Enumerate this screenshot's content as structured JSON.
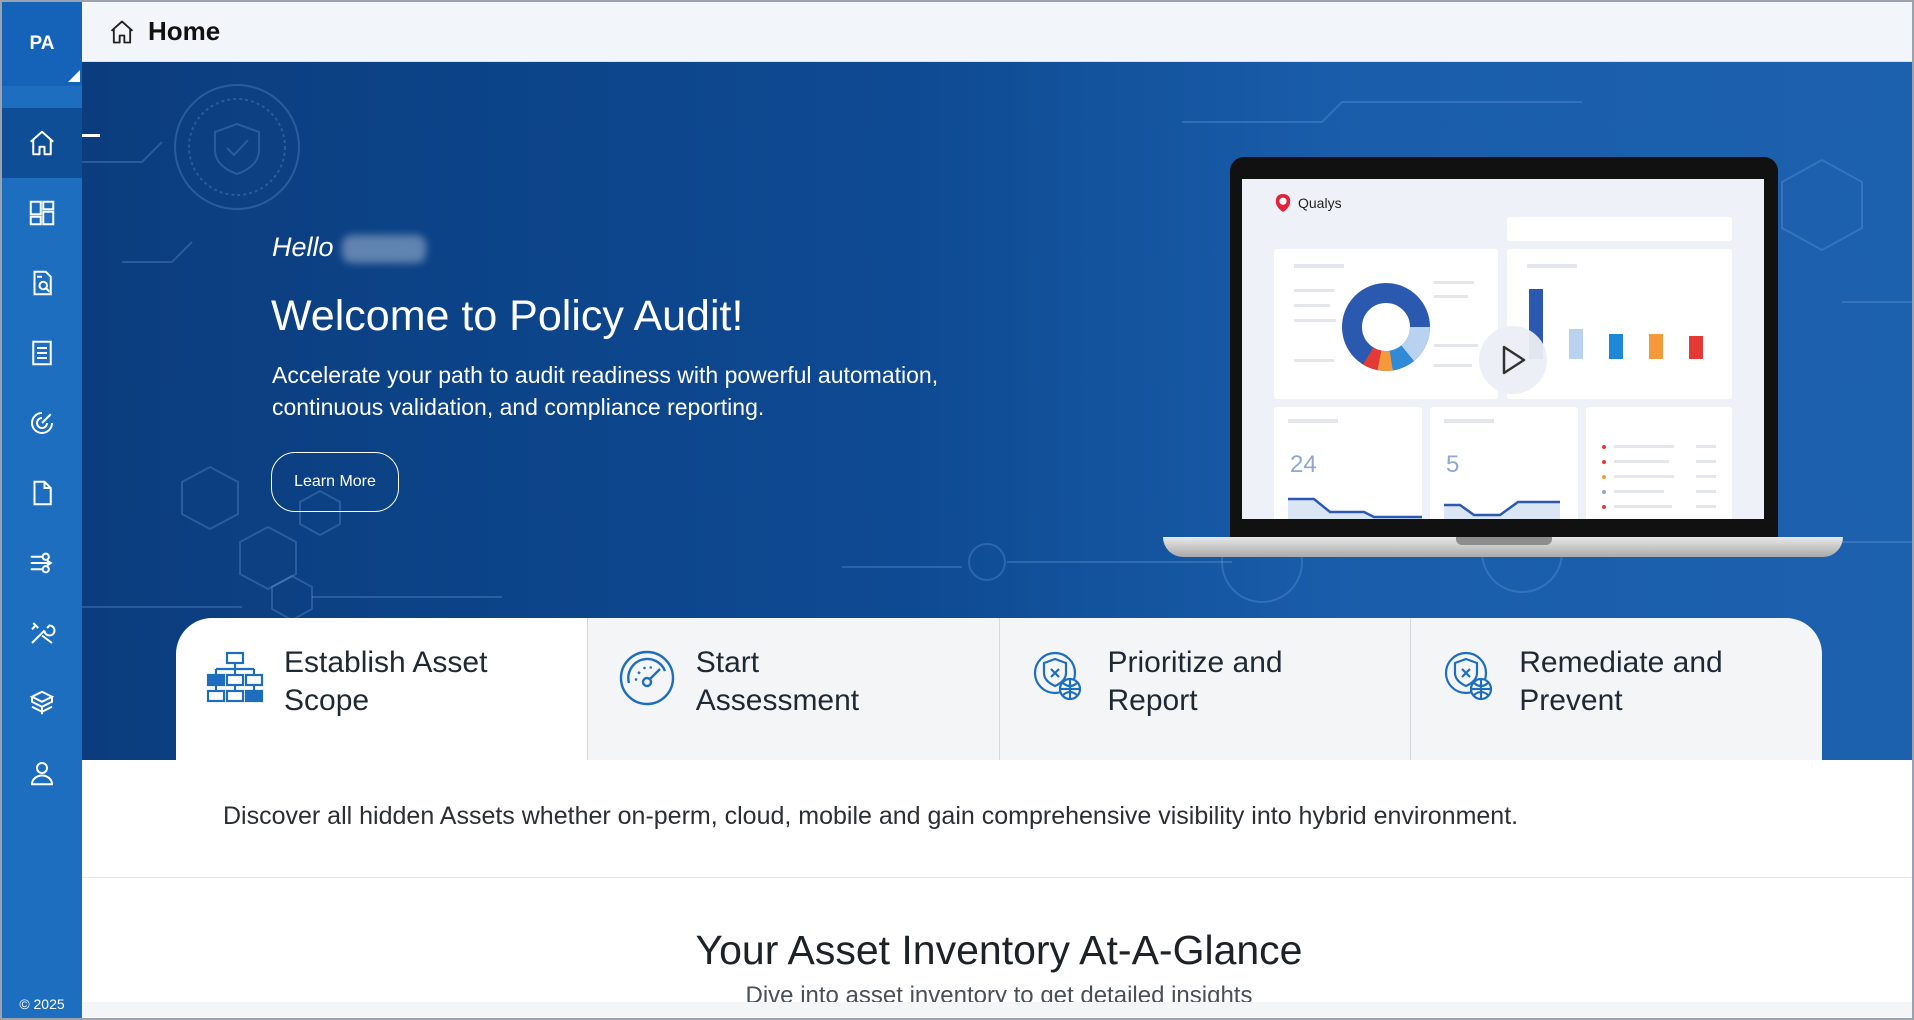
{
  "app": {
    "badge": "PA",
    "copyright": "© 2025"
  },
  "header": {
    "title": "Home"
  },
  "sidebar": {
    "items": [
      {
        "name": "home",
        "icon": "home-icon",
        "active": true
      },
      {
        "name": "dashboard",
        "icon": "dashboard-icon"
      },
      {
        "name": "scan-report",
        "icon": "document-search-icon"
      },
      {
        "name": "policies",
        "icon": "list-document-icon"
      },
      {
        "name": "assessment",
        "icon": "gauge-icon"
      },
      {
        "name": "reports",
        "icon": "file-icon"
      },
      {
        "name": "exceptions",
        "icon": "flow-icon"
      },
      {
        "name": "tools",
        "icon": "tools-icon"
      },
      {
        "name": "assets",
        "icon": "box-stack-icon"
      },
      {
        "name": "users",
        "icon": "user-icon"
      }
    ]
  },
  "hero": {
    "greeting": "Hello",
    "title": "Welcome to Policy Audit!",
    "subtitle": "Accelerate your path to audit readiness with powerful automation, continuous validation, and compliance reporting.",
    "learn_more": "Learn More",
    "screen": {
      "brand": "Qualys",
      "num1": "24",
      "num2": "5"
    }
  },
  "steps": [
    {
      "label": "Establish Asset Scope",
      "icon": "hierarchy-icon"
    },
    {
      "label": "Start Assessment",
      "icon": "gauge-icon"
    },
    {
      "label": "Prioritize and Report",
      "icon": "shield-report-icon"
    },
    {
      "label": "Remediate and Prevent",
      "icon": "shield-remediate-icon"
    }
  ],
  "content": {
    "description": "Discover all hidden Assets whether on-perm, cloud, mobile and gain comprehensive visibility into hybrid environment.",
    "inventory_title": "Your Asset Inventory At-A-Glance",
    "inventory_sub": "Dive into asset inventory to get detailed insights"
  },
  "colors": {
    "sidebar": "#1e6ec0",
    "accent": "#1463b8",
    "hero": "#0e4a93"
  }
}
